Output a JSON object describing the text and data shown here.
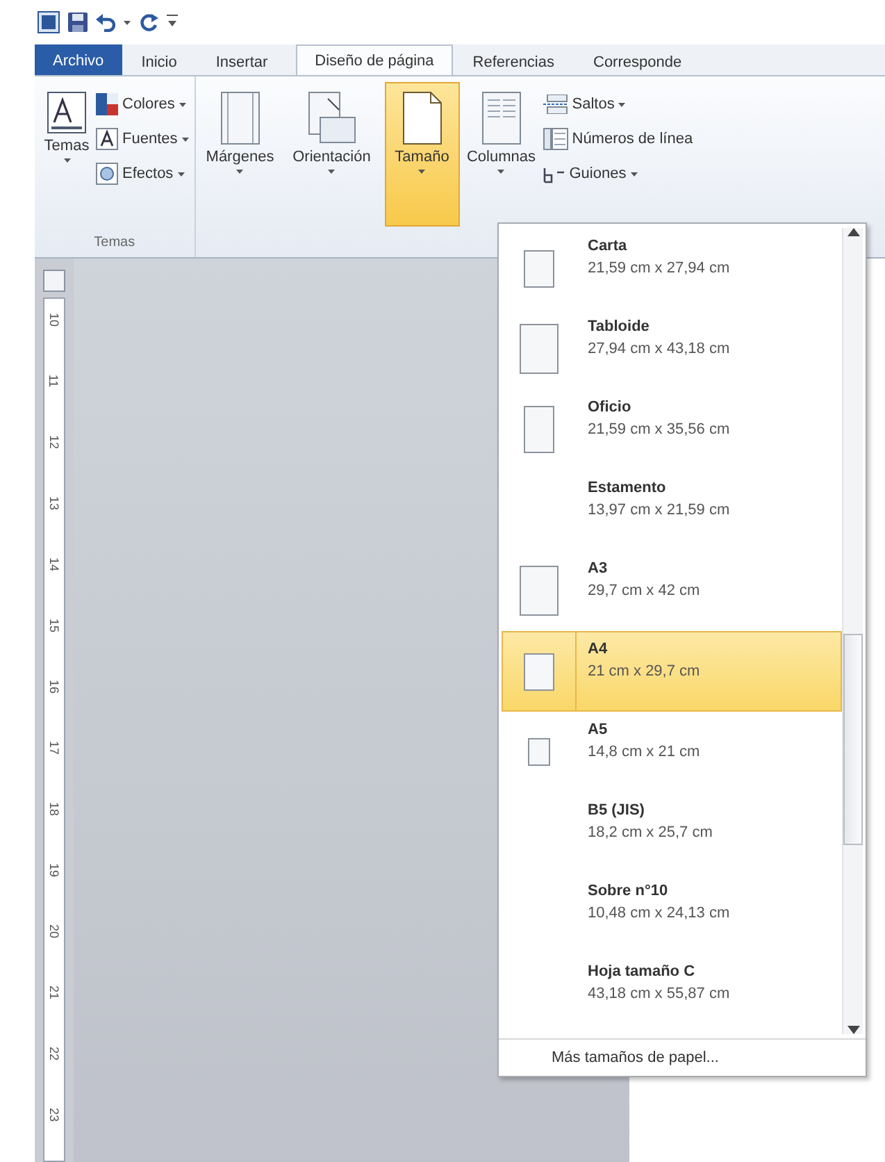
{
  "tabs": [
    {
      "label": "Archivo",
      "kind": "file",
      "selected": false
    },
    {
      "label": "Inicio",
      "kind": "tab",
      "selected": false
    },
    {
      "label": "Insertar",
      "kind": "tab",
      "selected": false
    },
    {
      "label": "Diseño de página",
      "kind": "tab",
      "selected": true
    },
    {
      "label": "Referencias",
      "kind": "tab",
      "selected": false
    },
    {
      "label": "Corresponde",
      "kind": "tab",
      "selected": false
    }
  ],
  "ribbon": {
    "themes_group": {
      "label": "Temas",
      "big_button": "Temas",
      "small_buttons": [
        {
          "label": "Colores",
          "kind": "colors"
        },
        {
          "label": "Fuentes",
          "kind": "fonts"
        },
        {
          "label": "Efectos",
          "kind": "effects"
        }
      ]
    },
    "page_setup_group": {
      "big_buttons": [
        {
          "label": "Márgenes",
          "kind": "margins",
          "selected": false
        },
        {
          "label": "Orientación",
          "kind": "orientation",
          "selected": false
        },
        {
          "label": "Tamaño",
          "kind": "size",
          "selected": true
        },
        {
          "label": "Columnas",
          "kind": "columns",
          "selected": false
        }
      ],
      "small_buttons": [
        {
          "label": "Saltos",
          "kind": "breaks"
        },
        {
          "label": "Números de línea",
          "kind": "numbers"
        },
        {
          "label": "Guiones",
          "kind": "hyphens"
        }
      ]
    }
  },
  "ruler": [
    "10",
    "11",
    "12",
    "13",
    "14",
    "15",
    "16",
    "17",
    "18",
    "19",
    "20",
    "21",
    "22",
    "23"
  ],
  "size_menu": {
    "items": [
      {
        "name": "Carta",
        "size": "21,59 cm x 27,94 cm",
        "kind": "small",
        "selected": false
      },
      {
        "name": "Tabloide",
        "size": "27,94 cm x 43,18 cm",
        "kind": "large",
        "selected": false
      },
      {
        "name": "Oficio",
        "size": "21,59 cm x 35,56 cm",
        "kind": "tall",
        "selected": false
      },
      {
        "name": "Estamento",
        "size": "13,97 cm x 21,59 cm",
        "kind": "plain",
        "selected": false
      },
      {
        "name": "A3",
        "size": "29,7 cm x 42 cm",
        "kind": "large",
        "selected": false
      },
      {
        "name": "A4",
        "size": "21 cm x 29,7 cm",
        "kind": "small",
        "selected": true
      },
      {
        "name": "A5",
        "size": "14,8 cm x 21 cm",
        "kind": "tiny",
        "selected": false
      },
      {
        "name": "B5 (JIS)",
        "size": "18,2 cm x 25,7 cm",
        "kind": "plain",
        "selected": false
      },
      {
        "name": "Sobre n°10",
        "size": "10,48 cm x 24,13 cm",
        "kind": "plain",
        "selected": false
      },
      {
        "name": "Hoja tamaño C",
        "size": "43,18 cm x 55,87 cm",
        "kind": "plain",
        "selected": false
      }
    ],
    "footer": "Más tamaños de papel..."
  }
}
